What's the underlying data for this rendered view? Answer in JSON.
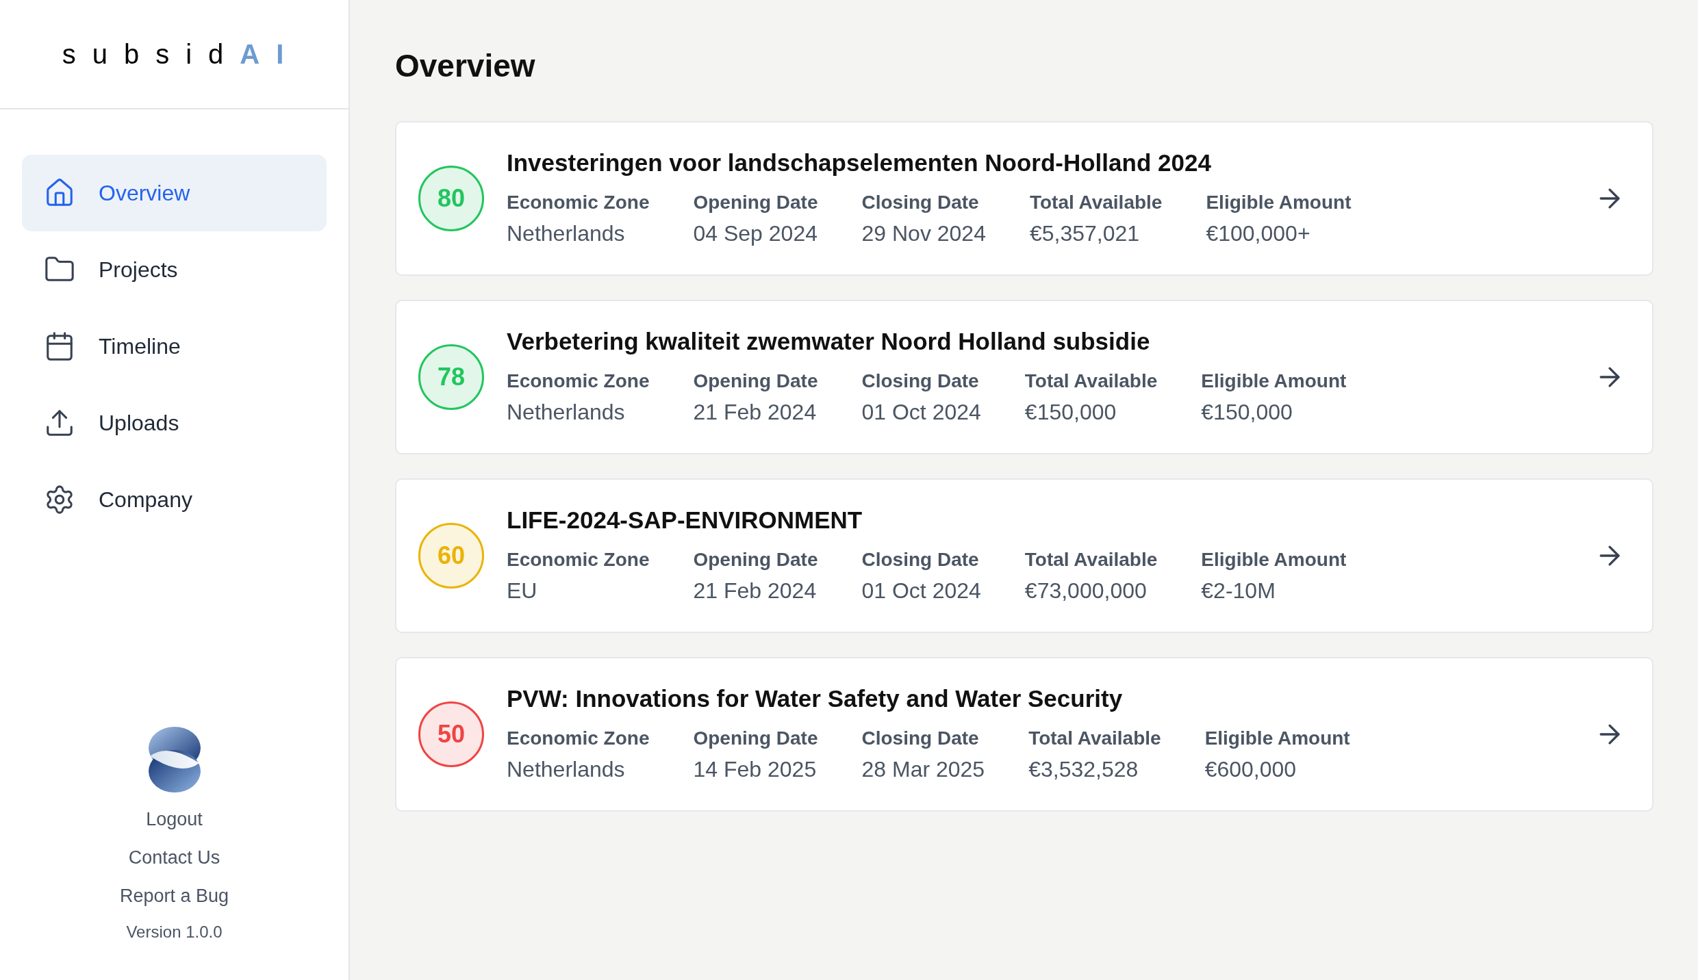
{
  "logo": {
    "text": "subsid",
    "accent": "AI"
  },
  "nav": [
    {
      "label": "Overview",
      "kind": "home",
      "selected": true
    },
    {
      "label": "Projects",
      "kind": "folder",
      "selected": false
    },
    {
      "label": "Timeline",
      "kind": "calendar",
      "selected": false
    },
    {
      "label": "Uploads",
      "kind": "upload",
      "selected": false
    },
    {
      "label": "Company",
      "kind": "settings",
      "selected": false
    }
  ],
  "footer_links": [
    "Logout",
    "Contact Us",
    "Report a Bug"
  ],
  "version": "Version 1.0.0",
  "page_title": "Overview",
  "grants": [
    {
      "score": "80",
      "color": "#22c55e",
      "title": "Investeringen voor landschapselementen Noord-Holland 2024",
      "fields": [
        {
          "label": "Economic Zone",
          "value": "Netherlands"
        },
        {
          "label": "Opening Date",
          "value": "04 Sep 2024"
        },
        {
          "label": "Closing Date",
          "value": "29 Nov 2024"
        },
        {
          "label": "Total Available",
          "value": "€5,357,021"
        },
        {
          "label": "Eligible Amount",
          "value": "€100,000+"
        }
      ]
    },
    {
      "score": "78",
      "color": "#22c55e",
      "title": "Verbetering kwaliteit zwemwater Noord Holland subsidie",
      "fields": [
        {
          "label": "Economic Zone",
          "value": "Netherlands"
        },
        {
          "label": "Opening Date",
          "value": "21 Feb 2024"
        },
        {
          "label": "Closing Date",
          "value": "01 Oct 2024"
        },
        {
          "label": "Total Available",
          "value": "€150,000"
        },
        {
          "label": "Eligible Amount",
          "value": "€150,000"
        }
      ]
    },
    {
      "score": "60",
      "color": "#eab308",
      "title": "LIFE-2024-SAP-ENVIRONMENT",
      "fields": [
        {
          "label": "Economic Zone",
          "value": "EU"
        },
        {
          "label": "Opening Date",
          "value": "21 Feb 2024"
        },
        {
          "label": "Closing Date",
          "value": "01 Oct 2024"
        },
        {
          "label": "Total Available",
          "value": "€73,000,000"
        },
        {
          "label": "Eligible Amount",
          "value": "€2-10M"
        }
      ]
    },
    {
      "score": "50",
      "color": "#ef4444",
      "title": "PVW: Innovations for Water Safety and Water Security",
      "fields": [
        {
          "label": "Economic Zone",
          "value": "Netherlands"
        },
        {
          "label": "Opening Date",
          "value": "14 Feb 2025"
        },
        {
          "label": "Closing Date",
          "value": "28 Mar 2025"
        },
        {
          "label": "Total Available",
          "value": "€3,532,528"
        },
        {
          "label": "Eligible Amount",
          "value": "€600,000"
        }
      ]
    }
  ]
}
